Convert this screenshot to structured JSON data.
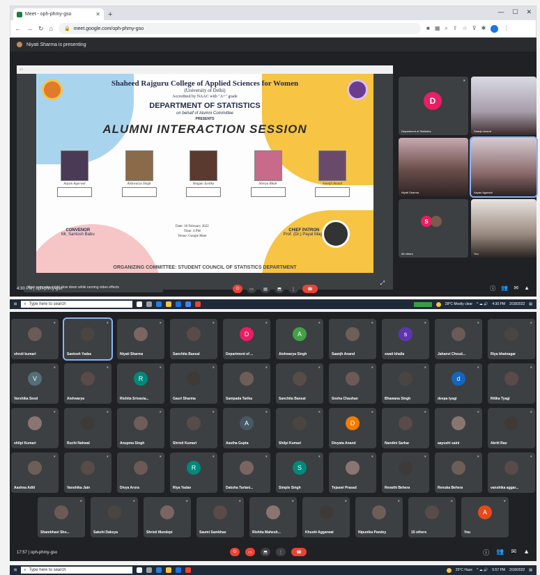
{
  "browser": {
    "tab_title": "Meet - oph-phmy-gso",
    "url": "meet.google.com/oph-phmy-gso"
  },
  "meet1": {
    "presenting_banner": "Niyati Sharma is presenting",
    "toast": "Your computer might slow down while running video effects",
    "time_meeting": "4:30 PM  |  oph-phmy-gso",
    "slide": {
      "college": "Shaheed Rajguru College of Applied Sciences for Women",
      "university": "(University of Delhi)",
      "accreditation": "Accredited by NAAC with \"A+\" grade",
      "department": "DEPARTMENT OF STATISTICS",
      "behalf": "on behalf of Alumni Committee",
      "presents": "PRESENTS",
      "session": "ALUMNI INTERACTION SESSION",
      "alumni": [
        "Aayan Agarwal",
        "Aishwarya Singh",
        "Shagun Jyotika",
        "Shreya Bhatt",
        "Saanjh Anand"
      ],
      "convenor_title": "CONVENOR",
      "convenor_name": "Mr. Santosh Babu",
      "date": "Date: 18 February 2022",
      "time": "Time: 4 PM",
      "venue": "Venue: Google Meet",
      "patron_title": "CHIEF PATRON",
      "patron_name": "Prof. (Dr.) Payal Mago",
      "organizer": "ORGANIZING COMMITTEE: STUDENT COUNCIL OF STATISTICS DEPARTMENT"
    },
    "tiles": {
      "dept": "Department of Statistics",
      "dept_initial": "D",
      "top_right": "Saanjh Anand",
      "niyati": "Niyati Sharma",
      "aayan": "Aayan Agarwal",
      "others": "68 others",
      "you": "You"
    }
  },
  "taskbar1": {
    "search": "Type here to search",
    "weather": "28°C  Mostly clear",
    "clock": "4:30 PM",
    "date": "2/18/2022"
  },
  "meet2": {
    "time_meeting": "17:57  |  oph-phmy-gso",
    "rows": [
      [
        {
          "name": "shruti kumari"
        },
        {
          "name": "Santosh Yadav"
        },
        {
          "name": "Niyati Sharma"
        },
        {
          "name": "Sanchita Bansal"
        },
        {
          "name": "Department of ...",
          "initial": "D",
          "color": "#e91e63"
        },
        {
          "name": "Aishwarya Singh",
          "initial": "A",
          "color": "#43a047"
        },
        {
          "name": "Saanjh Anand"
        },
        {
          "name": "swati bhalla",
          "initial": "s",
          "color": "#5e35b1"
        },
        {
          "name": "Jahanvi Choud..."
        },
        {
          "name": "Riya bhatnagar"
        }
      ],
      [
        {
          "name": "Varshika Sood",
          "initial": "V",
          "color": "#546e7a"
        },
        {
          "name": "Aishwarya"
        },
        {
          "name": "Rishita Srivasta...",
          "initial": "R",
          "color": "#00897b"
        },
        {
          "name": "Gauri Sharma"
        },
        {
          "name": "Sampada Tarika"
        },
        {
          "name": "Sanchita Bansal"
        },
        {
          "name": "Sneha Chauhan"
        },
        {
          "name": "Bhawana Singh"
        },
        {
          "name": "deepa tyagi",
          "initial": "d",
          "color": "#1565c0"
        },
        {
          "name": "Ritika Tyagi"
        }
      ],
      [
        {
          "name": "shilpi Kumari"
        },
        {
          "name": "Ruchi Nahwal"
        },
        {
          "name": "Anupma Singh"
        },
        {
          "name": "Shristi Kumari"
        },
        {
          "name": "Aastha Gupta",
          "initial": "A",
          "color": "#455a64"
        },
        {
          "name": "Shilpi Kumari"
        },
        {
          "name": "Divyata Anand",
          "initial": "D",
          "color": "#f57c00"
        },
        {
          "name": "Nandini Sarkar"
        },
        {
          "name": "aayushi saini"
        },
        {
          "name": "Akriti Rao"
        }
      ],
      [
        {
          "name": "Aashna Aditi"
        },
        {
          "name": "Vanshika Jain"
        },
        {
          "name": "Divya Arora"
        },
        {
          "name": "Riya Yadav",
          "initial": "R",
          "color": "#00897b"
        },
        {
          "name": "Daksha Tarlani..."
        },
        {
          "name": "Simple Singh",
          "initial": "S",
          "color": "#00897b"
        },
        {
          "name": "Tejaswi Prasad"
        },
        {
          "name": "Revathi Behera"
        },
        {
          "name": "Renuka Behera"
        },
        {
          "name": "vanshika aggar..."
        }
      ],
      [
        {
          "name": "Shambhavi Sho..."
        },
        {
          "name": "Sakshi Daksya"
        },
        {
          "name": "Shristi Mundepi"
        },
        {
          "name": "Saumi Sambhav"
        },
        {
          "name": "Rishita Mahesh..."
        },
        {
          "name": "Khushi Aggarwal"
        },
        {
          "name": "Nipunika Pandey"
        },
        {
          "name": "15 others"
        },
        {
          "name": "You",
          "initial": "A",
          "color": "#e64a19"
        }
      ]
    ]
  },
  "taskbar2": {
    "search": "Type here to search",
    "weather": "25°C  Haze",
    "clock": "5:57 PM",
    "date": "2/18/2022"
  },
  "colors": {
    "meet_bg": "#202124",
    "tile_bg": "#3c4043",
    "end_call": "#ea4335",
    "accent": "#1a73e8"
  }
}
